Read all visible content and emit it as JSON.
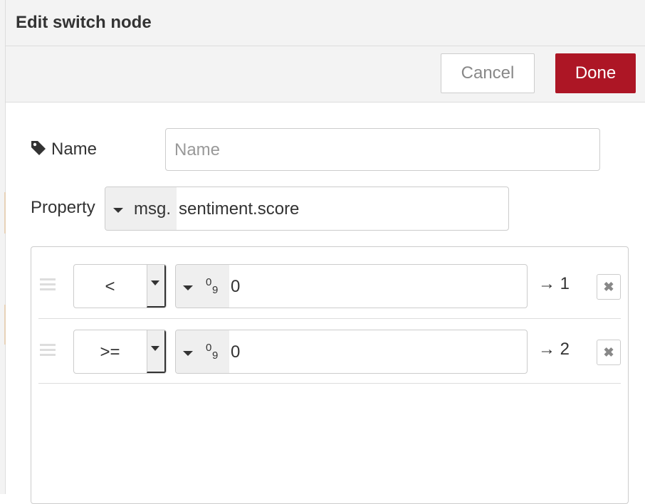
{
  "dialog": {
    "title": "Edit switch node",
    "cancel_label": "Cancel",
    "done_label": "Done",
    "accent_color": "#ad1625"
  },
  "form": {
    "name_label": "Name",
    "name_placeholder": "Name",
    "name_value": "",
    "name_icon": "tag-icon",
    "property_label": "Property",
    "property_prefix": "msg.",
    "property_value": "sentiment.score"
  },
  "rules": [
    {
      "operator": "<",
      "type_icon": "number-icon",
      "value": "0",
      "output": "→ 1"
    },
    {
      "operator": ">=",
      "type_icon": "number-icon",
      "value": "0",
      "output": "→ 2"
    }
  ],
  "icons": {
    "number_top": "0",
    "number_bottom": "9",
    "remove": "✖"
  }
}
